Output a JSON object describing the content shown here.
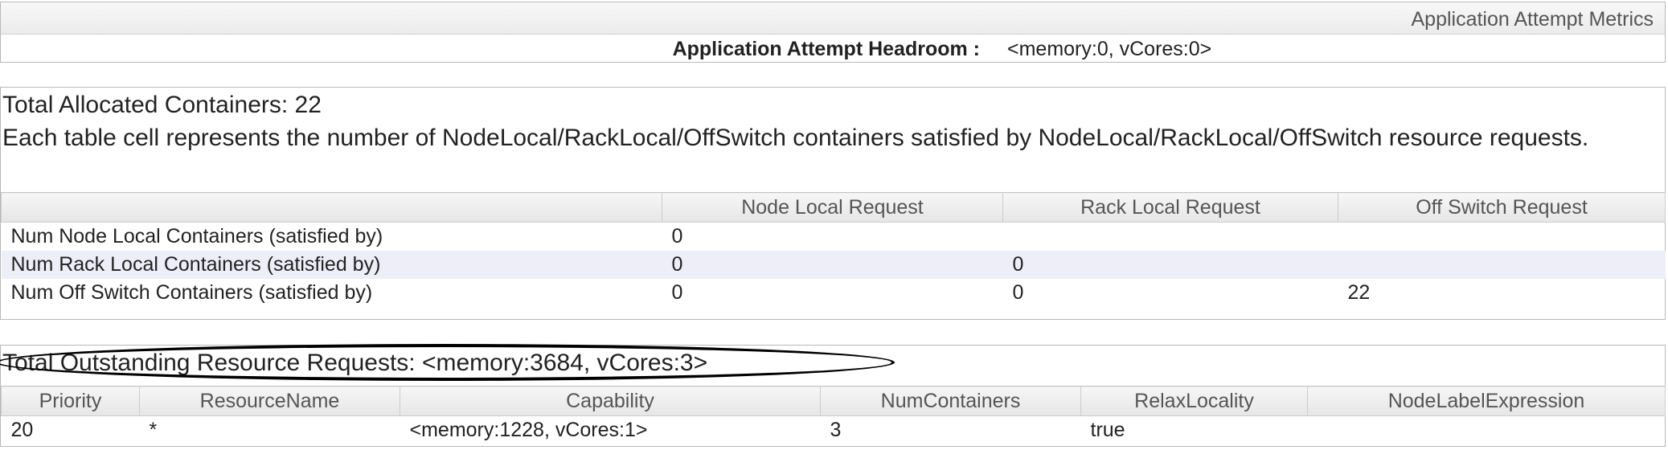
{
  "metrics": {
    "caption": "Application Attempt Metrics",
    "headroom_label": "Application Attempt Headroom :",
    "headroom_value": "<memory:0, vCores:0>"
  },
  "allocated": {
    "title": "Total Allocated Containers: 22",
    "description": "Each table cell represents the number of NodeLocal/RackLocal/OffSwitch containers satisfied by NodeLocal/RackLocal/OffSwitch resource requests.",
    "columns": [
      "",
      "Node Local Request",
      "Rack Local Request",
      "Off Switch Request"
    ],
    "rows": [
      [
        "Num Node Local Containers (satisfied by)",
        "0",
        "",
        ""
      ],
      [
        "Num Rack Local Containers (satisfied by)",
        "0",
        "0",
        ""
      ],
      [
        "Num Off Switch Containers (satisfied by)",
        "0",
        "0",
        "22"
      ]
    ]
  },
  "outstanding": {
    "title": "Total Outstanding Resource Requests: <memory:3684, vCores:3>",
    "columns": [
      "Priority",
      "ResourceName",
      "Capability",
      "NumContainers",
      "RelaxLocality",
      "NodeLabelExpression"
    ],
    "rows": [
      [
        "20",
        "*",
        "<memory:1228, vCores:1>",
        "3",
        "true",
        ""
      ]
    ]
  }
}
